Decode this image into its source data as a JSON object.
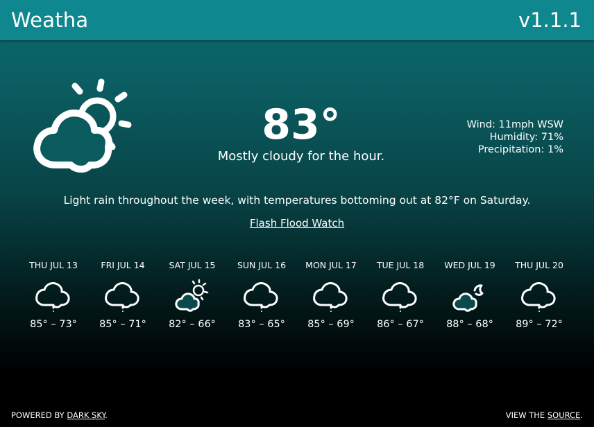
{
  "header": {
    "title": "Weatha",
    "version": "v1.1.1"
  },
  "current": {
    "icon": "partly-cloudy-day-icon",
    "temperature": "83°",
    "summary": "Mostly cloudy for the hour.",
    "wind": "Wind: 11mph WSW",
    "humidity": "Humidity: 71%",
    "precipitation": "Precipitation: 1%"
  },
  "week": {
    "summary": "Light rain throughout the week, with temperatures bottoming out at 82°F on Saturday.",
    "alert": "Flash Flood Watch"
  },
  "forecast": [
    {
      "label": "THU JUL 13",
      "icon": "rain-icon",
      "range": "85° – 73°"
    },
    {
      "label": "FRI JUL 14",
      "icon": "rain-icon",
      "range": "85° – 71°"
    },
    {
      "label": "SAT JUL 15",
      "icon": "partly-cloudy-day-icon",
      "range": "82° – 66°"
    },
    {
      "label": "SUN JUL 16",
      "icon": "rain-icon",
      "range": "83° – 65°"
    },
    {
      "label": "MON JUL 17",
      "icon": "rain-icon",
      "range": "85° – 69°"
    },
    {
      "label": "TUE JUL 18",
      "icon": "rain-icon",
      "range": "86° – 67°"
    },
    {
      "label": "WED JUL 19",
      "icon": "partly-cloudy-night-icon",
      "range": "88° – 68°"
    },
    {
      "label": "THU JUL 20",
      "icon": "rain-icon",
      "range": "89° – 72°"
    }
  ],
  "footer": {
    "powered_prefix": "POWERED BY ",
    "powered_link": "DARK SKY",
    "powered_suffix": ".",
    "source_prefix": "VIEW THE ",
    "source_link": "SOURCE",
    "source_suffix": "."
  },
  "colors": {
    "header_bg": "#0e878f",
    "gradient_top": "#0e7b80",
    "gradient_bottom": "#000000",
    "text": "#ffffff"
  }
}
